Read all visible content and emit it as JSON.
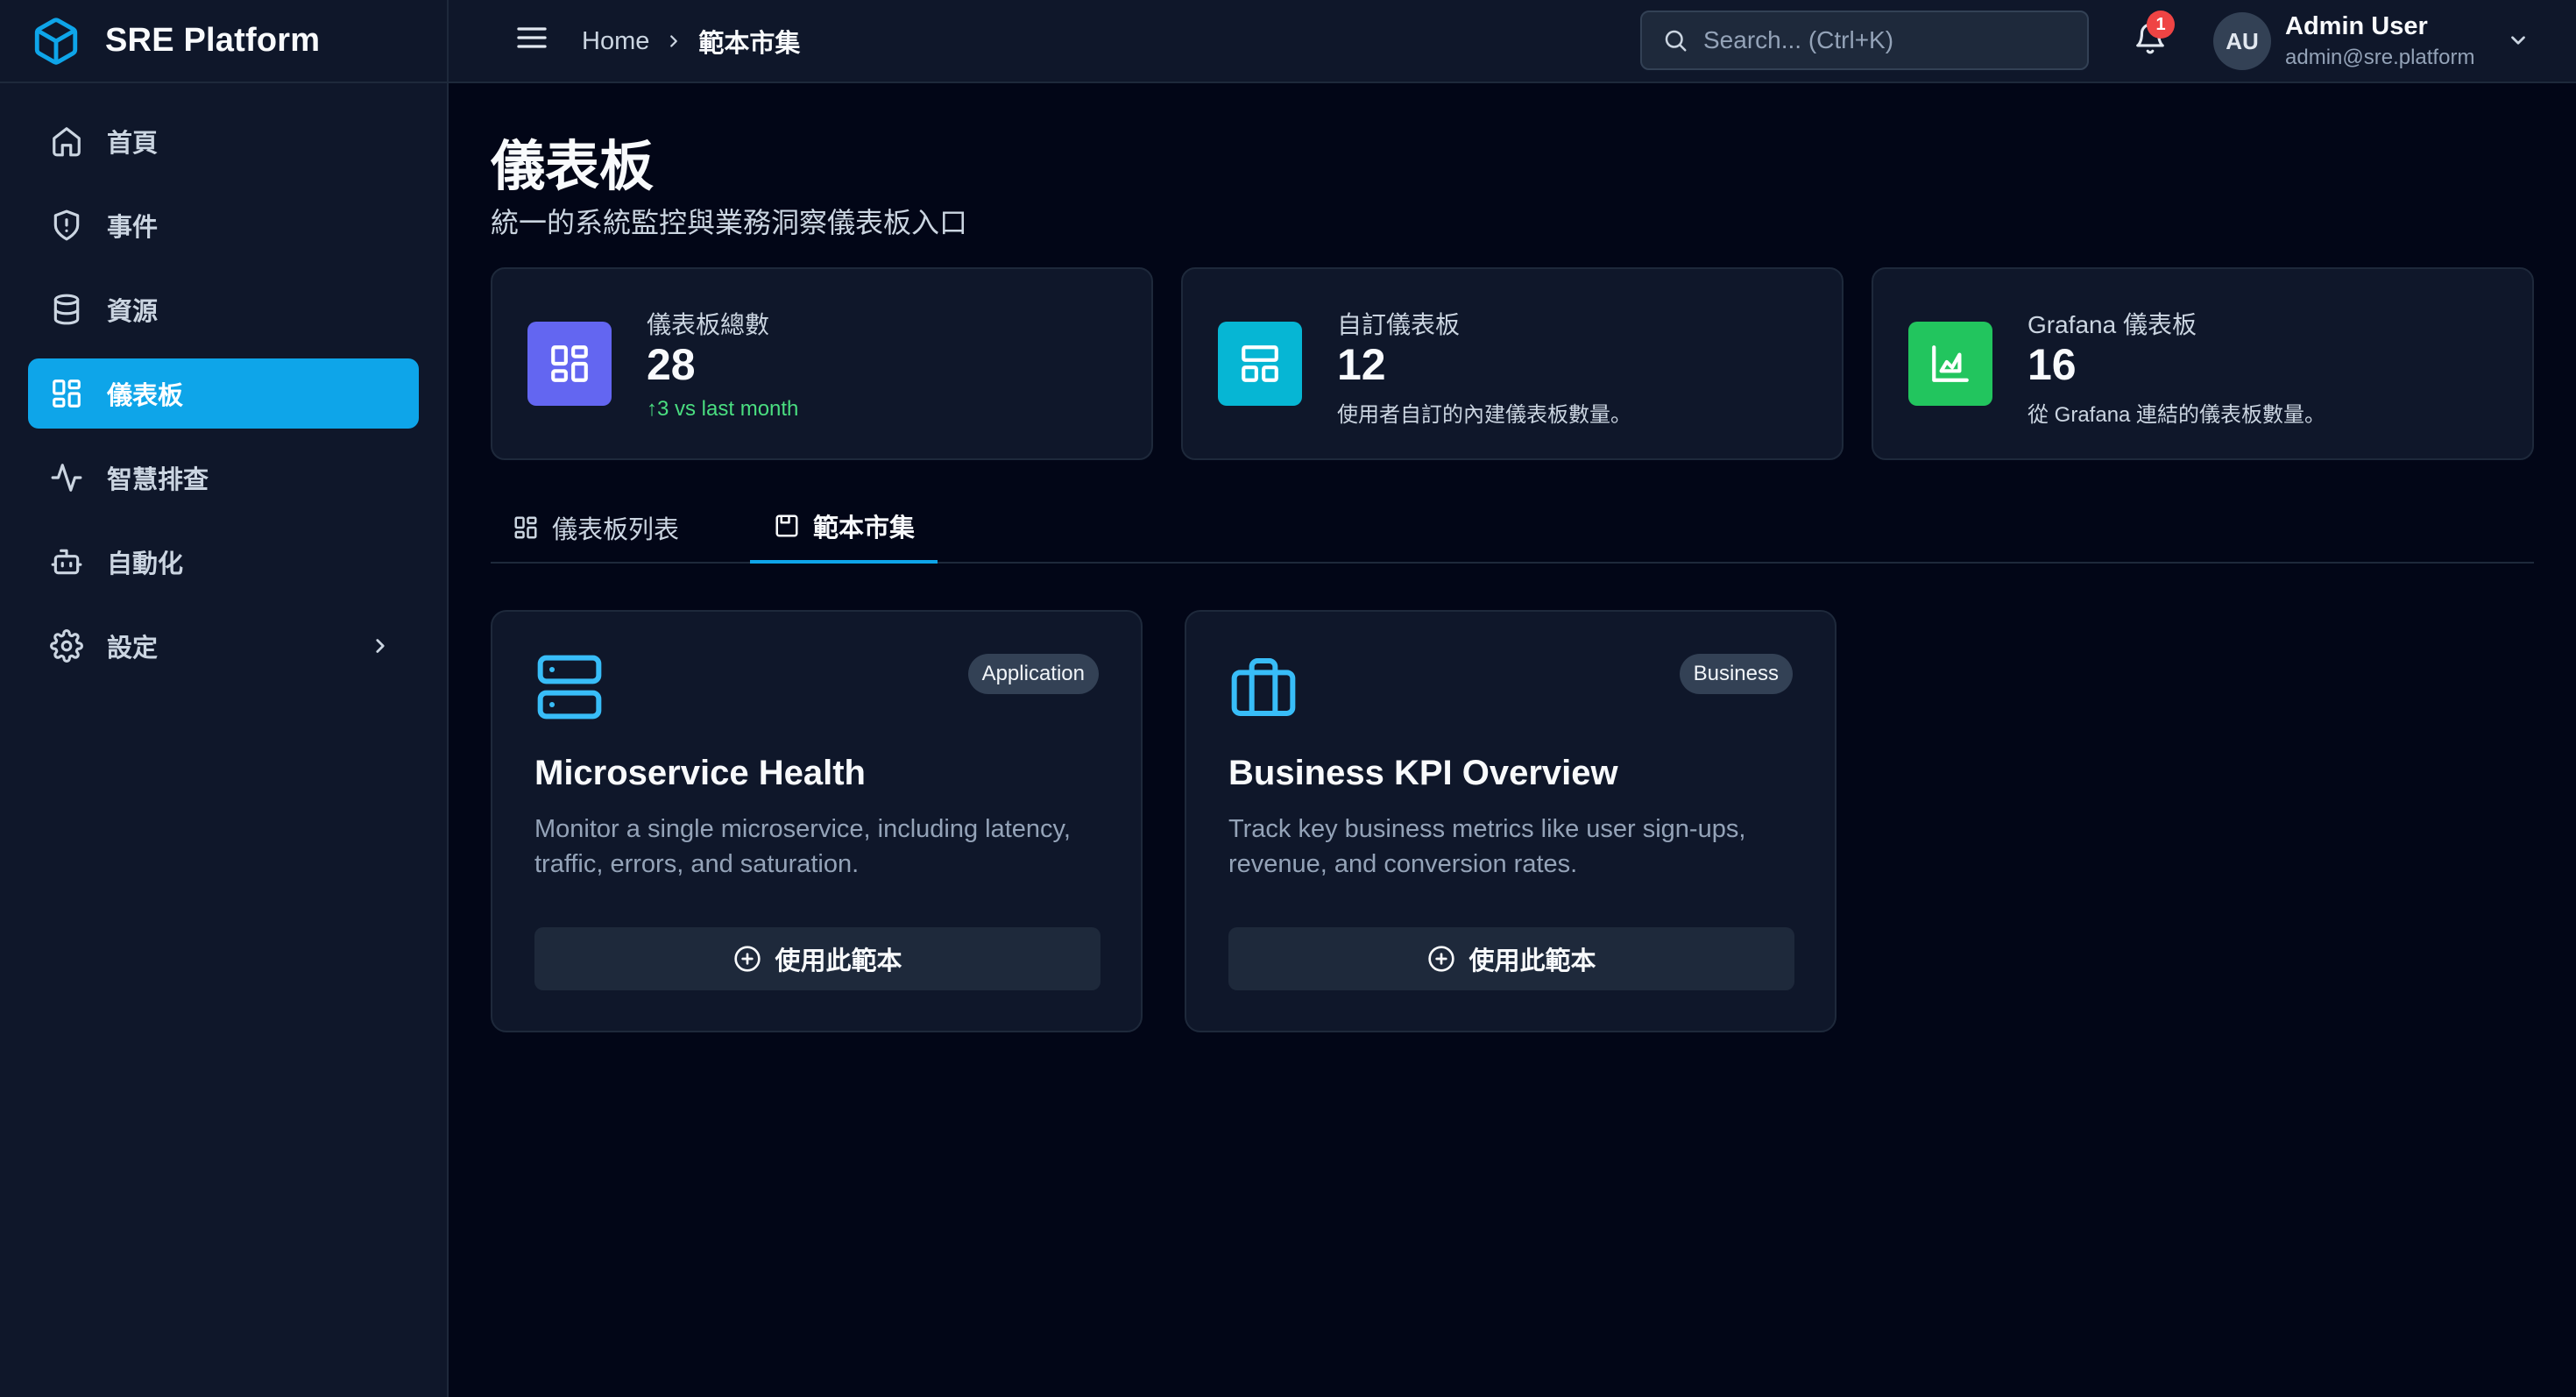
{
  "app": {
    "name": "SRE Platform"
  },
  "sidebar": {
    "items": [
      {
        "label": "首頁",
        "icon": "home-icon"
      },
      {
        "label": "事件",
        "icon": "shield-alert-icon"
      },
      {
        "label": "資源",
        "icon": "database-icon"
      },
      {
        "label": "儀表板",
        "icon": "dashboard-grid-icon",
        "active": true
      },
      {
        "label": "智慧排查",
        "icon": "activity-icon"
      },
      {
        "label": "自動化",
        "icon": "bot-icon"
      },
      {
        "label": "設定",
        "icon": "gear-icon",
        "has_submenu": true
      }
    ]
  },
  "header": {
    "breadcrumb": {
      "home": "Home",
      "current": "範本市集"
    },
    "search": {
      "placeholder": "Search... (Ctrl+K)"
    },
    "notifications": {
      "count": "1"
    },
    "user": {
      "initials": "AU",
      "name": "Admin User",
      "email": "admin@sre.platform"
    }
  },
  "page": {
    "title": "儀表板",
    "subtitle": "統一的系統監控與業務洞察儀表板入口"
  },
  "stats": [
    {
      "label": "儀表板總數",
      "value": "28",
      "note": "↑3 vs last month",
      "color": "#6366f1",
      "icon": "dashboard-grid-icon"
    },
    {
      "label": "自訂儀表板",
      "value": "12",
      "note": "使用者自訂的內建儀表板數量。",
      "color": "#06b6d4",
      "icon": "layout-icon"
    },
    {
      "label": "Grafana 儀表板",
      "value": "16",
      "note": "從 Grafana 連結的儀表板數量。",
      "color": "#22c55e",
      "icon": "area-chart-icon"
    }
  ],
  "tabs": [
    {
      "label": "儀表板列表",
      "icon": "dashboard-grid-icon"
    },
    {
      "label": "範本市集",
      "icon": "store-icon",
      "active": true
    }
  ],
  "templates": [
    {
      "badge": "Application",
      "title": "Microservice Health",
      "description": "Monitor a single microservice, including latency, traffic, errors, and saturation.",
      "button": "使用此範本",
      "icon": "server-icon"
    },
    {
      "badge": "Business",
      "title": "Business KPI Overview",
      "description": "Track key business metrics like user sign-ups, revenue, and conversion rates.",
      "button": "使用此範本",
      "icon": "briefcase-icon"
    }
  ],
  "colors": {
    "accent": "#0ea5e9",
    "background": "#020617",
    "surface": "#0f172a",
    "badge_red": "#ef4444",
    "positive": "#4ade80"
  }
}
